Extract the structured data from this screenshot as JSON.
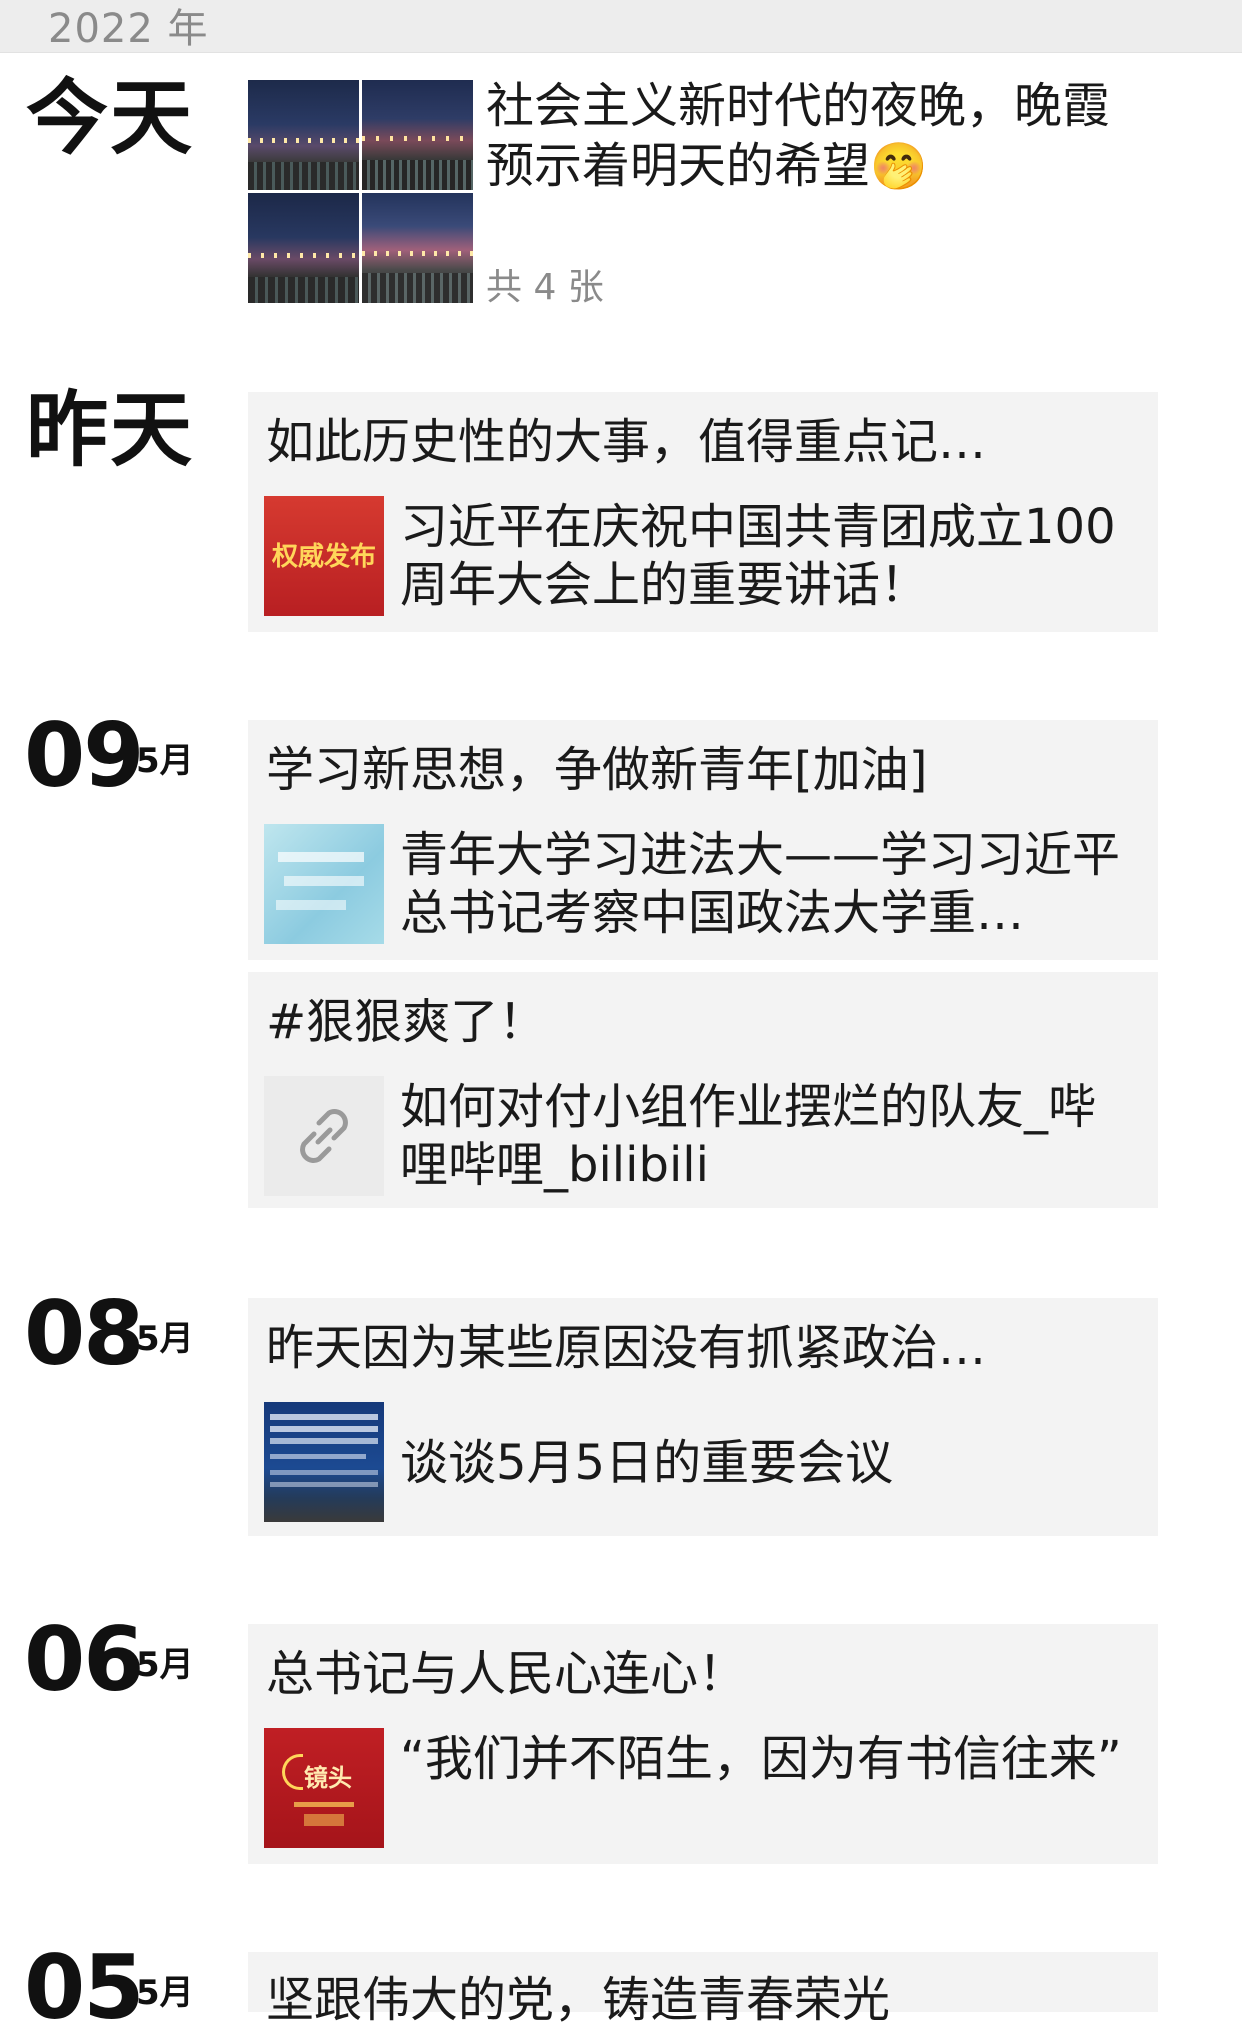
{
  "year_header": "2022 年",
  "moments": {
    "today": {
      "day_label": "今天",
      "text": "社会主义新时代的夜晚，晚霞预示着明天的希望",
      "emoji": "🤭",
      "photo_count": "共 4 张"
    },
    "yesterday": {
      "day_label": "昨天",
      "caption": "如此历史性的大事，值得重点记…",
      "thumb_text": "权威发布",
      "link_title": "习近平在庆祝中国共青团成立100周年大会上的重要讲话！"
    },
    "may09": {
      "day": "09",
      "month": "5月",
      "posts": [
        {
          "caption": "学习新思想，争做新青年[加油]",
          "link_title": "青年大学习进法大——学习习近平总书记考察中国政法大学重…"
        },
        {
          "caption": "#狠狠爽了！",
          "link_title": "如何对付小组作业摆烂的队友_哔哩哔哩_bilibili",
          "thumb_icon": "link-icon"
        }
      ]
    },
    "may08": {
      "day": "08",
      "month": "5月",
      "caption": "昨天因为某些原因没有抓紧政治…",
      "link_title": "谈谈5月5日的重要会议"
    },
    "may06": {
      "day": "06",
      "month": "5月",
      "caption": "总书记与人民心连心！",
      "thumb_text": "镜头",
      "link_title": "“我们并不陌生，因为有书信往来”"
    },
    "may05": {
      "day": "05",
      "month": "5月",
      "caption": "坚跟伟大的党，铸造青春荣光"
    }
  },
  "colors": {
    "card_bg": "#f3f3f3",
    "year_bar_bg": "#ededed",
    "secondary_text": "#8a8a8a",
    "red_thumb": "#c8262a"
  }
}
